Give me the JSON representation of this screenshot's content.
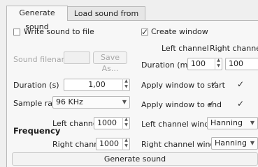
{
  "tabs": [
    {
      "label": "Generate sound"
    },
    {
      "label": "Load sound from disk"
    }
  ],
  "left": {
    "write_sound": {
      "label": "Write sound to file",
      "checked": false
    },
    "sound_filename": {
      "label": "Sound filename",
      "value": ""
    },
    "save_as": "Save As...",
    "duration": {
      "label": "Duration (s)",
      "value": "1,00"
    },
    "sample_rate": {
      "label": "Sample rate",
      "value": "96 KHz"
    },
    "frequency": {
      "label": "Frequency",
      "left_label": "Left channel",
      "left_value": "1000",
      "right_label": "Right channel",
      "right_value": "1000"
    }
  },
  "right": {
    "create_window": {
      "label": "Create window",
      "checked": true
    },
    "left_channel_header": "Left channel",
    "right_channel_header": "Right channel",
    "duration_ms": {
      "label": "Duration (ms)",
      "left": "100",
      "right": "100"
    },
    "apply_start": {
      "label": "Apply window to start"
    },
    "apply_end": {
      "label": "Apply window to end"
    },
    "left_window": {
      "label": "Left channel window",
      "value": "Hanning"
    },
    "right_window": {
      "label": "Right channel window",
      "value": "Hanning"
    }
  },
  "generate_button": "Generate sound"
}
